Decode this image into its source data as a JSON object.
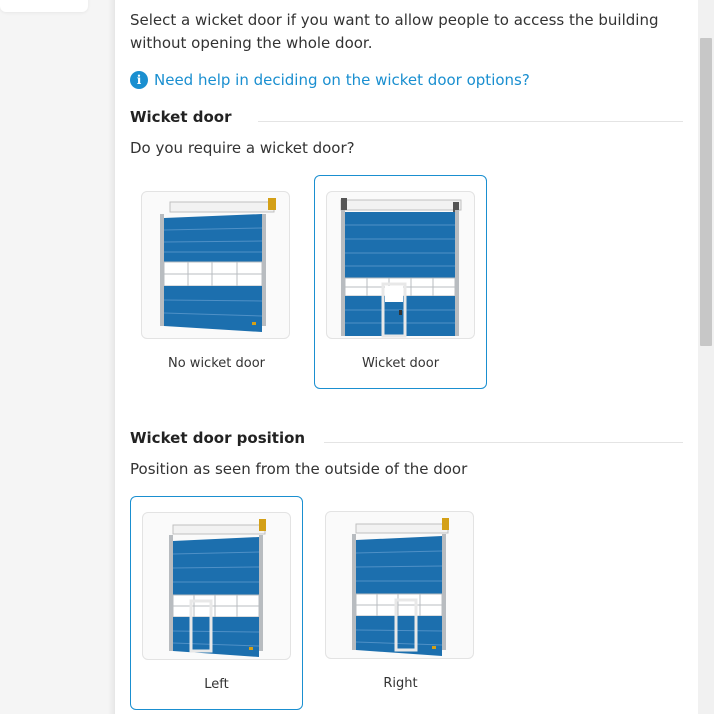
{
  "intro_text": "Select a wicket door if you want to allow people to access the building without opening the whole door.",
  "help": {
    "icon": "info-icon",
    "link_text": "Need help in deciding on the wicket door options?"
  },
  "wicket_section": {
    "title": "Wicket door",
    "question": "Do you require a wicket door?",
    "options": [
      {
        "label": "No wicket door",
        "selected": false
      },
      {
        "label": "Wicket door",
        "selected": true
      }
    ]
  },
  "position_section": {
    "title": "Wicket door position",
    "question": "Position as seen from the outside of the door",
    "options": [
      {
        "label": "Left",
        "selected": true
      },
      {
        "label": "Right",
        "selected": false
      }
    ]
  },
  "colors": {
    "accent": "#1a8fd0",
    "door_blue": "#1c6fae",
    "frame_grey": "#b8bcc0"
  }
}
